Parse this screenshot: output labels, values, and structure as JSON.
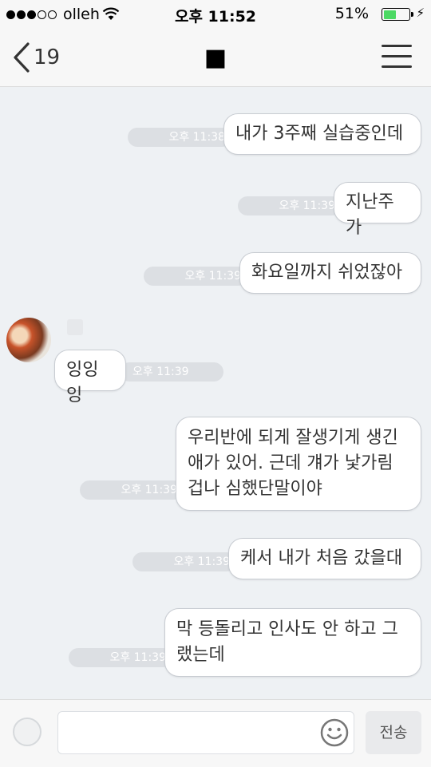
{
  "status_bar": {
    "carrier": "olleh",
    "time": "오후 11:52",
    "battery_percent": "51%",
    "battery_level": 0.51,
    "battery_color": "#4cd964"
  },
  "nav": {
    "back_count": "19",
    "title": "■",
    "back_icon": "chevron-left-icon",
    "menu_icon": "hamburger-menu-icon"
  },
  "messages": [
    {
      "side": "me",
      "text": "내가 3주째 실습중인데",
      "time": "오후 11:38"
    },
    {
      "side": "me",
      "text": "지난주가",
      "time": "오후 11:39"
    },
    {
      "side": "me",
      "text": "화요일까지 쉬었잖아",
      "time": "오후 11:39"
    },
    {
      "side": "other",
      "text": "잉잉잉",
      "time": "오후 11:39"
    },
    {
      "side": "me",
      "text": "우리반에 되게 잘생기게 생긴\n애가 있어. 근데 걔가 낯가림\n겁나 심했단말이야",
      "time": "오후 11:39"
    },
    {
      "side": "me",
      "text": "케서 내가 처음 갔을대",
      "time": "오후 11:39"
    },
    {
      "side": "me",
      "text": "막 등돌리고 인사도 안 하고 그\n랬는데",
      "time": "오후 11:39"
    }
  ],
  "input_bar": {
    "placeholder": "",
    "send_label": "전송",
    "emoji_icon": "smiley-icon"
  }
}
